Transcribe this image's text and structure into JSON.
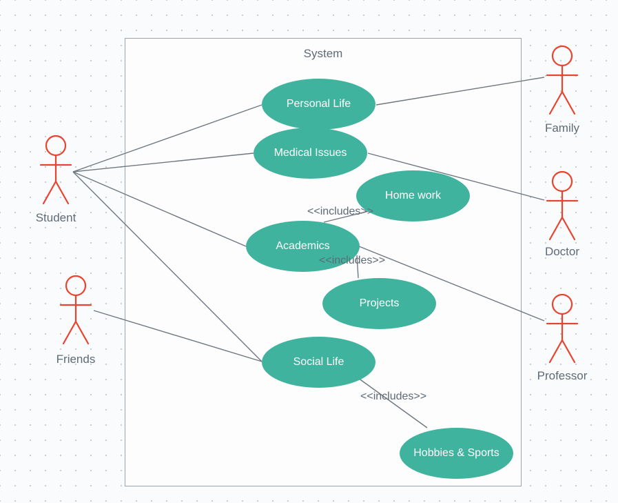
{
  "system": {
    "title": "System"
  },
  "usecases": {
    "personal": "Personal Life",
    "medical": "Medical Issues",
    "homework": "Home work",
    "academics": "Academics",
    "projects": "Projects",
    "social": "Social Life",
    "hobbies": "Hobbies & Sports"
  },
  "actors": {
    "student": "Student",
    "friends": "Friends",
    "family": "Family",
    "doctor": "Doctor",
    "professor": "Professor"
  },
  "relations": {
    "includes": "<<includes>>"
  }
}
